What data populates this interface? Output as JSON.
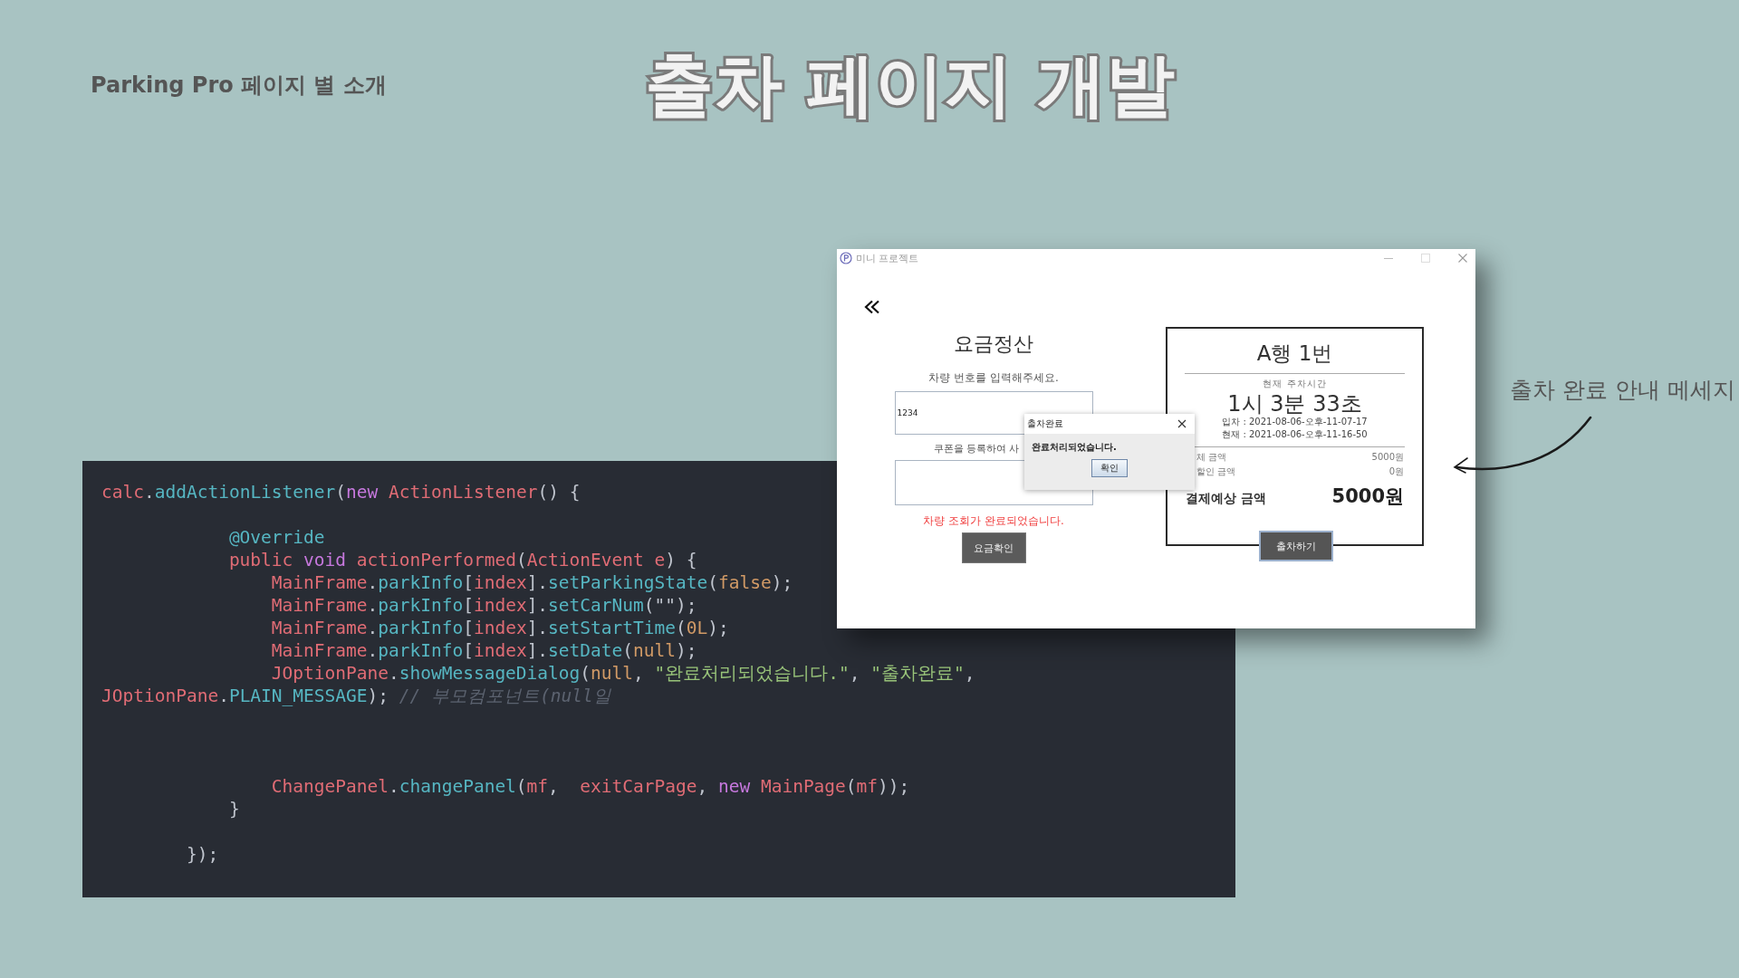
{
  "slide": {
    "section_label": "Parking Pro 페이지 별 소개",
    "title": "출차 페이지 개발",
    "annotation": "출차 완료 안내 메세지"
  },
  "code": {
    "lines": [
      {
        "kind": "top",
        "tokens": [
          {
            "kind": "name",
            "text": "calc"
          },
          {
            "kind": "plain",
            "text": "."
          },
          {
            "kind": "method",
            "text": "addActionListener"
          },
          {
            "kind": "plain",
            "text": "("
          },
          {
            "kind": "keyword",
            "text": "new "
          },
          {
            "kind": "name",
            "text": "ActionListener"
          },
          {
            "kind": "plain",
            "text": "() {"
          }
        ]
      },
      {
        "kind": "blank"
      },
      {
        "kind": "method",
        "tokens": [
          {
            "kind": "method",
            "text": "@Override"
          }
        ]
      },
      {
        "kind": "method",
        "tokens": [
          {
            "kind": "name",
            "text": "public "
          },
          {
            "kind": "keyword",
            "text": "void "
          },
          {
            "kind": "name",
            "text": "actionPerformed"
          },
          {
            "kind": "plain",
            "text": "("
          },
          {
            "kind": "name",
            "text": "ActionEvent e"
          },
          {
            "kind": "plain",
            "text": ") {"
          }
        ]
      },
      {
        "kind": "body",
        "tokens": [
          {
            "kind": "name",
            "text": "MainFrame"
          },
          {
            "kind": "plain",
            "text": "."
          },
          {
            "kind": "method",
            "text": "parkInfo"
          },
          {
            "kind": "plain",
            "text": "["
          },
          {
            "kind": "name",
            "text": "index"
          },
          {
            "kind": "plain",
            "text": "]."
          },
          {
            "kind": "method",
            "text": "setParkingState"
          },
          {
            "kind": "plain",
            "text": "("
          },
          {
            "kind": "number",
            "text": "false"
          },
          {
            "kind": "plain",
            "text": ");"
          }
        ]
      },
      {
        "kind": "body",
        "tokens": [
          {
            "kind": "name",
            "text": "MainFrame"
          },
          {
            "kind": "plain",
            "text": "."
          },
          {
            "kind": "method",
            "text": "parkInfo"
          },
          {
            "kind": "plain",
            "text": "["
          },
          {
            "kind": "name",
            "text": "index"
          },
          {
            "kind": "plain",
            "text": "]."
          },
          {
            "kind": "method",
            "text": "setCarNum"
          },
          {
            "kind": "plain",
            "text": "(\"\");"
          }
        ]
      },
      {
        "kind": "body",
        "tokens": [
          {
            "kind": "name",
            "text": "MainFrame"
          },
          {
            "kind": "plain",
            "text": "."
          },
          {
            "kind": "method",
            "text": "parkInfo"
          },
          {
            "kind": "plain",
            "text": "["
          },
          {
            "kind": "name",
            "text": "index"
          },
          {
            "kind": "plain",
            "text": "]."
          },
          {
            "kind": "method",
            "text": "setStartTime"
          },
          {
            "kind": "plain",
            "text": "("
          },
          {
            "kind": "number",
            "text": "0L"
          },
          {
            "kind": "plain",
            "text": ");"
          }
        ]
      },
      {
        "kind": "body",
        "tokens": [
          {
            "kind": "name",
            "text": "MainFrame"
          },
          {
            "kind": "plain",
            "text": "."
          },
          {
            "kind": "method",
            "text": "parkInfo"
          },
          {
            "kind": "plain",
            "text": "["
          },
          {
            "kind": "name",
            "text": "index"
          },
          {
            "kind": "plain",
            "text": "]."
          },
          {
            "kind": "method",
            "text": "setDate"
          },
          {
            "kind": "plain",
            "text": "("
          },
          {
            "kind": "number",
            "text": "null"
          },
          {
            "kind": "plain",
            "text": ");"
          }
        ]
      },
      {
        "kind": "body",
        "tokens": [
          {
            "kind": "name",
            "text": "JOptionPane"
          },
          {
            "kind": "plain",
            "text": "."
          },
          {
            "kind": "method",
            "text": "showMessageDialog"
          },
          {
            "kind": "plain",
            "text": "("
          },
          {
            "kind": "number",
            "text": "null"
          },
          {
            "kind": "plain",
            "text": ", "
          },
          {
            "kind": "string",
            "text": "\"완료처리되었습니다.\""
          },
          {
            "kind": "plain",
            "text": ", "
          },
          {
            "kind": "string",
            "text": "\"출차완료\""
          },
          {
            "kind": "plain",
            "text": ","
          }
        ]
      },
      {
        "kind": "top",
        "tokens": [
          {
            "kind": "name",
            "text": "JOptionPane"
          },
          {
            "kind": "plain",
            "text": "."
          },
          {
            "kind": "method",
            "text": "PLAIN_MESSAGE"
          },
          {
            "kind": "plain",
            "text": "); "
          },
          {
            "kind": "comment",
            "text": "// 부모컴포넌트(null일"
          }
        ]
      },
      {
        "kind": "blank"
      },
      {
        "kind": "blank"
      },
      {
        "kind": "blank"
      },
      {
        "kind": "body",
        "tokens": [
          {
            "kind": "name",
            "text": "ChangePanel"
          },
          {
            "kind": "plain",
            "text": "."
          },
          {
            "kind": "method",
            "text": "changePanel"
          },
          {
            "kind": "plain",
            "text": "("
          },
          {
            "kind": "name",
            "text": "mf"
          },
          {
            "kind": "plain",
            "text": ",  "
          },
          {
            "kind": "name",
            "text": "exitCarPage"
          },
          {
            "kind": "plain",
            "text": ", "
          },
          {
            "kind": "keyword",
            "text": "new "
          },
          {
            "kind": "name",
            "text": "MainPage"
          },
          {
            "kind": "plain",
            "text": "("
          },
          {
            "kind": "name",
            "text": "mf"
          },
          {
            "kind": "plain",
            "text": "));"
          }
        ]
      },
      {
        "kind": "method",
        "tokens": [
          {
            "kind": "plain",
            "text": "}"
          }
        ]
      },
      {
        "kind": "blank"
      },
      {
        "kind": "closing",
        "tokens": [
          {
            "kind": "plain",
            "text": "});"
          }
        ]
      }
    ]
  },
  "app_window": {
    "title": "미니 프로젝트",
    "fare_form": {
      "heading": "요금정산",
      "car_number_label": "차량 번호를 입력해주세요.",
      "car_number_value": "1234",
      "coupon_label": "쿠폰을 등록하여 사",
      "status_message": "차량 조회가 완료되었습니다.",
      "check_button": "요금확인"
    },
    "receipt": {
      "spot": "A행 1번",
      "duration_label": "현재 주차시간",
      "duration": "1시 3분 33초",
      "entry_time": "입차 : 2021-08-06-오후-11-07-17",
      "current_time": "현재 : 2021-08-06-오후-11-16-50",
      "rows": [
        {
          "label": "체 금액",
          "value": "5000원"
        },
        {
          "label": "할인 금액",
          "value": "0원"
        }
      ],
      "total_label": "결제예상 금액",
      "total": "5000원",
      "exit_button": "출차하기"
    },
    "dialog": {
      "title": "출차완료",
      "message": "완료처리되었습니다.",
      "ok_button": "확인"
    }
  }
}
